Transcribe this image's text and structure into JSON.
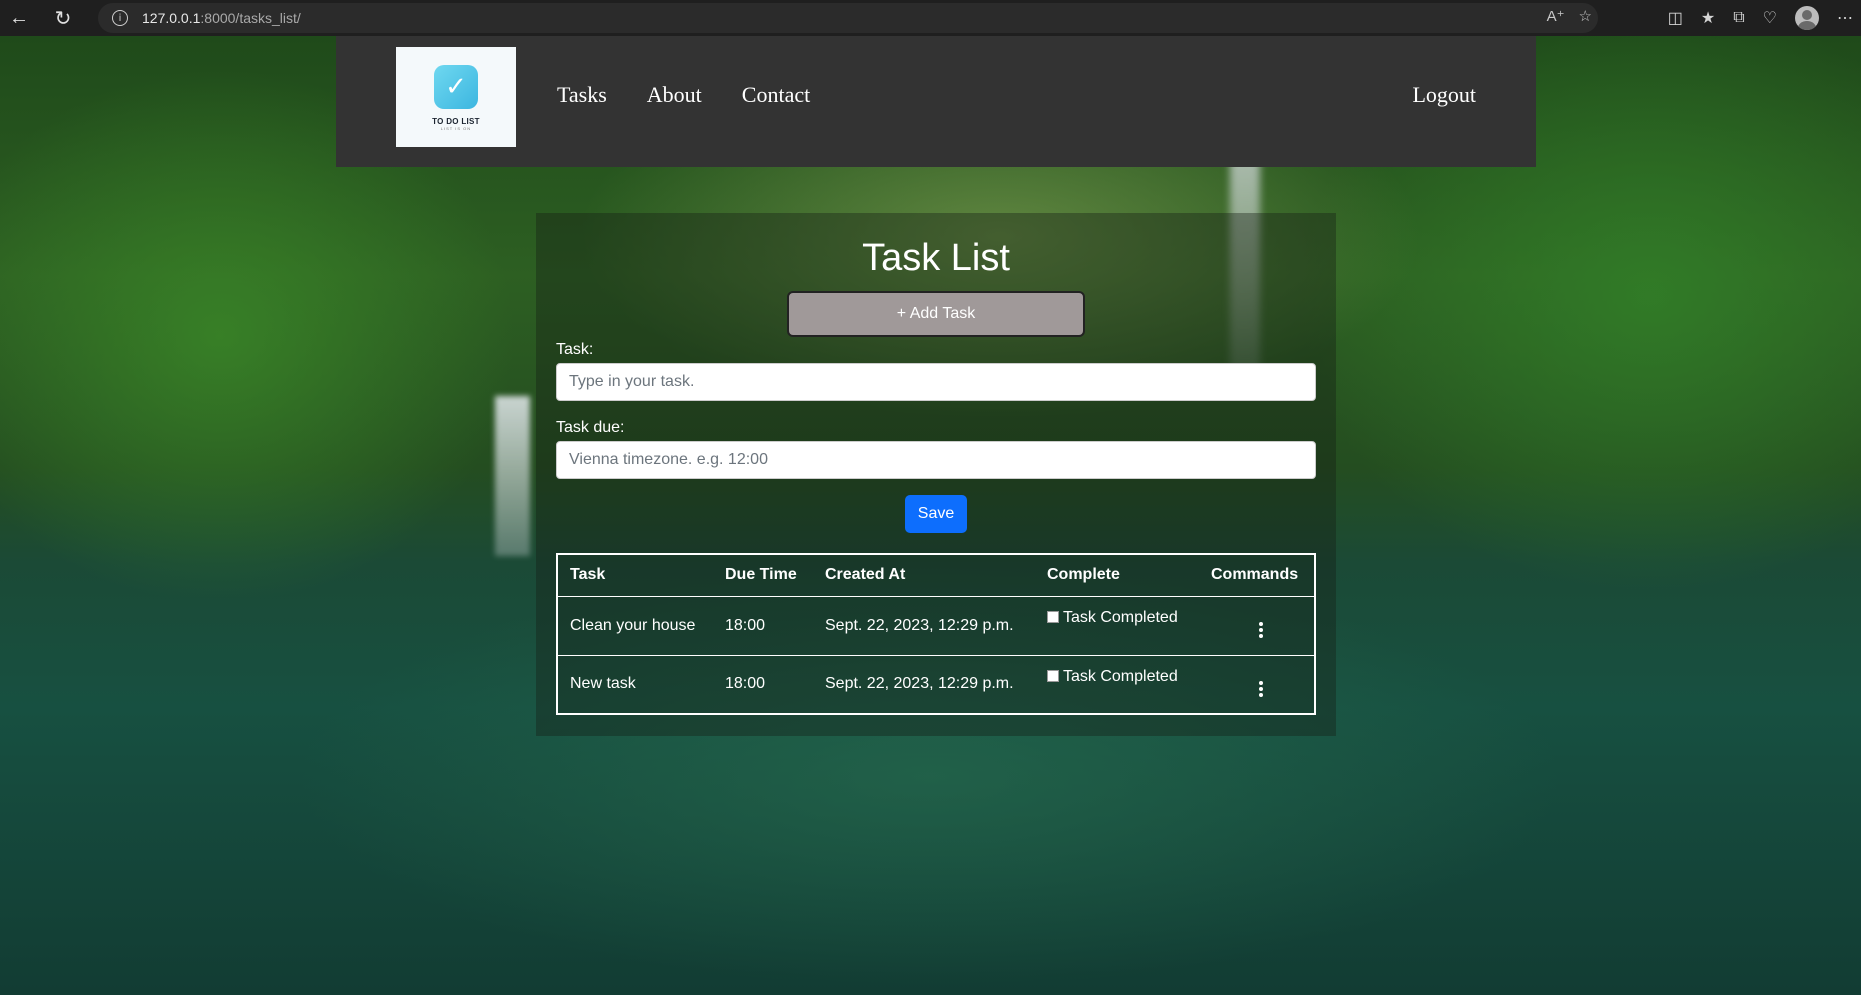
{
  "browser": {
    "url_host": "127.0.0.1",
    "url_rest": ":8000/tasks_list/"
  },
  "nav": {
    "logo_text": "TO DO LIST",
    "logo_sub": "LIST IS ON",
    "links": [
      "Tasks",
      "About",
      "Contact"
    ],
    "logout": "Logout"
  },
  "main": {
    "title": "Task List",
    "add_button": "+ Add Task",
    "task_label": "Task:",
    "task_placeholder": "Type in your task.",
    "due_label": "Task due:",
    "due_placeholder": "Vienna timezone. e.g. 12:00",
    "save_button": "Save"
  },
  "table": {
    "headers": [
      "Task",
      "Due Time",
      "Created At",
      "Complete",
      "Commands"
    ],
    "rows": [
      {
        "task": "Clean your house",
        "due": "18:00",
        "created": "Sept. 22, 2023, 12:29 p.m.",
        "complete_label": "Task Completed",
        "completed": false
      },
      {
        "task": "New task",
        "due": "18:00",
        "created": "Sept. 22, 2023, 12:29 p.m.",
        "complete_label": "Task Completed",
        "completed": false
      }
    ]
  },
  "colors": {
    "navbar_bg": "#333333",
    "save_button": "#0d6efd",
    "add_button": "#a09999"
  }
}
